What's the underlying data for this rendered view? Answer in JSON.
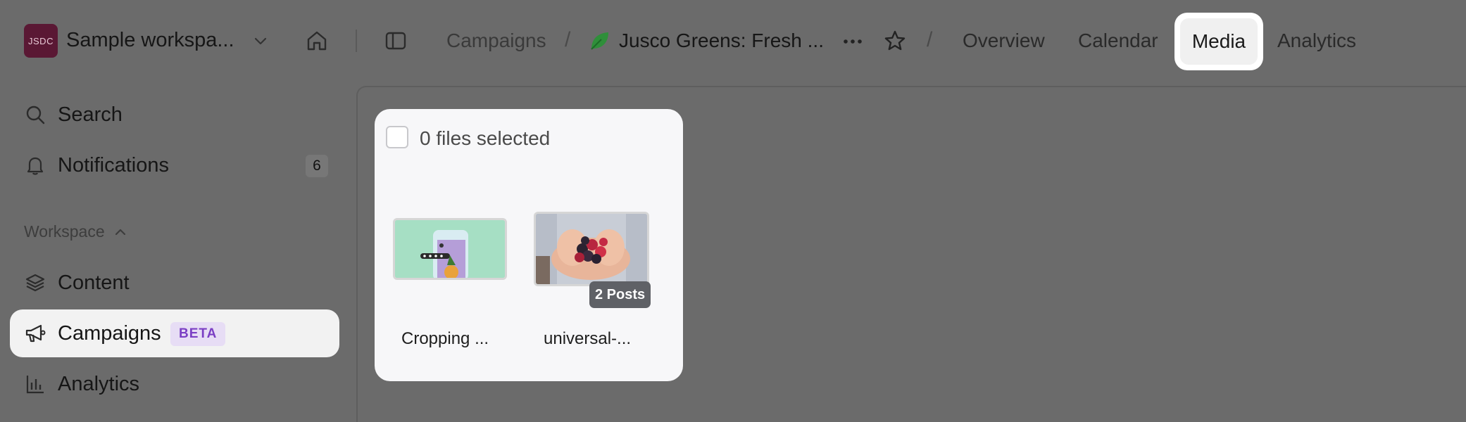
{
  "workspace": {
    "logo_text": "JSDC",
    "name": "Sample workspa...",
    "logo_color": "#5a1834"
  },
  "breadcrumb": {
    "items": [
      "Campaigns",
      "Jusco Greens: Fresh ..."
    ],
    "separator": "/"
  },
  "tabs": [
    {
      "label": "Overview"
    },
    {
      "label": "Calendar"
    },
    {
      "label": "Media",
      "active": true
    },
    {
      "label": "Analytics"
    }
  ],
  "icons": {
    "home": "home-icon",
    "sidebar_toggle": "sidebar-toggle-icon",
    "more": "more-horizontal-icon",
    "star": "star-icon",
    "leaf": "leaf-icon",
    "chevron": "chevron-down-icon"
  },
  "sidebar": {
    "search_label": "Search",
    "notifications_label": "Notifications",
    "notifications_count": "6",
    "section_label": "Workspace",
    "items": [
      {
        "label": "Content",
        "icon": "layers-icon"
      },
      {
        "label": "Campaigns",
        "icon": "megaphone-icon",
        "active": true,
        "badge": "BETA"
      },
      {
        "label": "Analytics",
        "icon": "bar-chart-icon"
      }
    ]
  },
  "media": {
    "selection_label": "0 files selected",
    "files": [
      {
        "name": "Cropping ...",
        "type": "image"
      },
      {
        "name": "universal-...",
        "type": "image",
        "posts_badge": "2 Posts"
      }
    ]
  },
  "colors": {
    "accent_purple": "#7b3fc4",
    "beta_bg": "#e7ddf5",
    "leaf_green": "#2f8f3a"
  }
}
